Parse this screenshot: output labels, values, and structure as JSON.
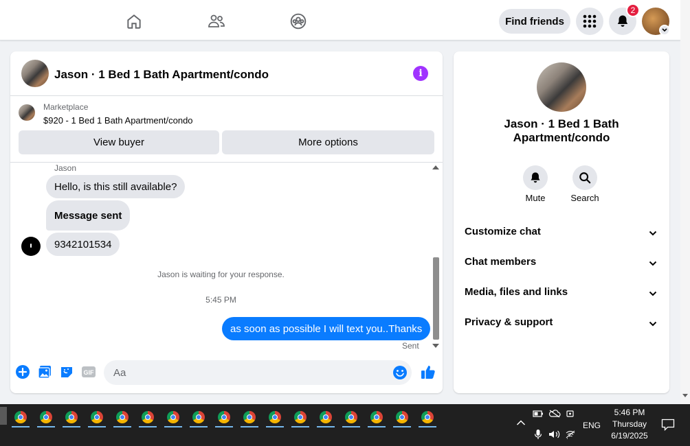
{
  "topnav": {
    "find_friends": "Find friends",
    "notification_count": "2",
    "icons": [
      "home-icon",
      "friends-icon",
      "groups-icon",
      "menu-grid-icon",
      "bell-icon"
    ]
  },
  "chat": {
    "title": "Jason · 1 Bed 1 Bath Apartment/condo",
    "marketplace": {
      "label": "Marketplace",
      "listing": "$920 - 1 Bed 1 Bath Apartment/condo",
      "view_buyer": "View buyer",
      "more_options": "More options"
    },
    "messages": {
      "sender": "Jason",
      "incoming": [
        "Hello, is this still available?",
        "Message sent",
        "9342101534"
      ],
      "waiting": "Jason is waiting for your response.",
      "time": "5:45 PM",
      "outgoing": "as soon as possible I will text you..Thanks",
      "status": "Sent"
    },
    "composer": {
      "placeholder": "Aa"
    }
  },
  "side": {
    "title": "Jason · 1 Bed 1 Bath Apartment/condo",
    "actions": {
      "mute": "Mute",
      "search": "Search"
    },
    "sections": [
      "Customize chat",
      "Chat members",
      "Media, files and links",
      "Privacy & support"
    ]
  },
  "taskbar": {
    "app_count": 17,
    "lang": "ENG",
    "time": "5:46 PM",
    "day": "Thursday",
    "date": "6/19/2025"
  },
  "colors": {
    "accent": "#0a7cff",
    "info": "#a033ff",
    "badge": "#e41e3f"
  }
}
